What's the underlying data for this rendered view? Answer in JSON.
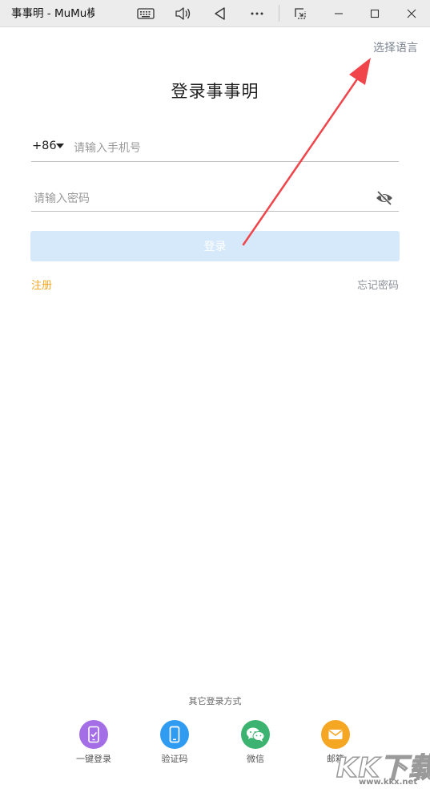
{
  "window": {
    "title": "事事明 - MuMu模拟器",
    "buttons": [
      "keyboard",
      "volume",
      "back",
      "more",
      "snap",
      "minimize",
      "maximize",
      "close"
    ]
  },
  "app": {
    "language_link": "选择语言",
    "title": "登录事事明",
    "phone": {
      "country_code": "+86",
      "placeholder": "请输入手机号",
      "value": ""
    },
    "password": {
      "placeholder": "请输入密码",
      "value": "",
      "visibility": "hidden"
    },
    "login_button": "登录",
    "register_link": "注册",
    "forgot_link": "忘记密码",
    "other_methods_label": "其它登录方式",
    "other_methods": [
      {
        "label": "一键登录",
        "icon": "phone-check-icon",
        "color": "#a46ee6"
      },
      {
        "label": "验证码",
        "icon": "smartphone-icon",
        "color": "#2f9bf1"
      },
      {
        "label": "微信",
        "icon": "wechat-icon",
        "color": "#3cb371"
      },
      {
        "label": "邮箱",
        "icon": "mail-icon",
        "color": "#f5a623"
      }
    ]
  },
  "colors": {
    "accent_orange": "#f5a623",
    "button_disabled_bg": "#d6e9fb",
    "annotation_arrow": "#f0454b"
  },
  "watermark": {
    "text": "KK下载",
    "sub": "www.kkx.net"
  }
}
